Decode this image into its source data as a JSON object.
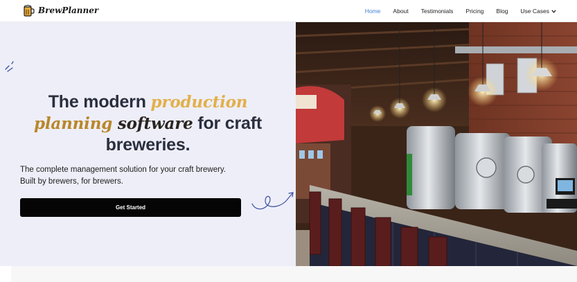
{
  "brand": {
    "name": "BrewPlanner",
    "icon": "beer-mug-icon"
  },
  "nav": {
    "items": [
      {
        "label": "Home",
        "active": true
      },
      {
        "label": "About",
        "active": false
      },
      {
        "label": "Testimonials",
        "active": false
      },
      {
        "label": "Pricing",
        "active": false
      },
      {
        "label": "Blog",
        "active": false
      },
      {
        "label": "Use Cases",
        "active": false,
        "dropdown": true
      }
    ]
  },
  "hero": {
    "headline": {
      "part1": "The modern ",
      "part2": "production",
      "part3": "planning ",
      "part4": "software",
      "part5": " for craft breweries."
    },
    "subtext_line1": "The complete management solution for your craft brewery.",
    "subtext_line2": "Built by brewers, for brewers.",
    "cta_label": "Get Started"
  },
  "colors": {
    "accent_gold": "#e2b04a",
    "accent_brown": "#b8872a",
    "nav_active": "#3f7fd0",
    "hero_bg": "#eeeef8",
    "cta_bg": "#050505"
  }
}
